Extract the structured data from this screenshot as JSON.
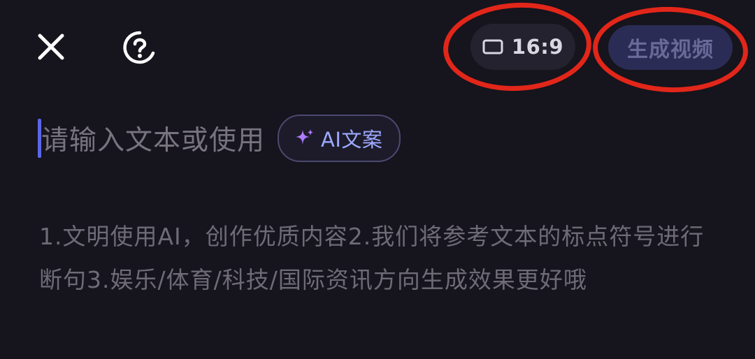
{
  "toolbar": {
    "close_icon": "close-icon",
    "help_icon": "help-icon",
    "aspect_ratio_icon": "aspect-ratio-icon",
    "aspect_ratio_label": "16:9",
    "generate_label": "生成视频"
  },
  "editor": {
    "placeholder": "请输入文本或使用",
    "ai_chip_icon": "sparkle-icon",
    "ai_chip_label": "AI文案",
    "hint_text": "1.文明使用AI，创作优质内容2.我们将参考文本的标点符号进行断句3.娱乐/体育/科技/国际资讯方向生成效果更好哦"
  },
  "colors": {
    "background": "#16141c",
    "accent": "#5a67e8",
    "ai_chip_text": "#9ca9ff",
    "annotation_red": "#e2261a",
    "generate_button_bg": "#2a2c55"
  }
}
